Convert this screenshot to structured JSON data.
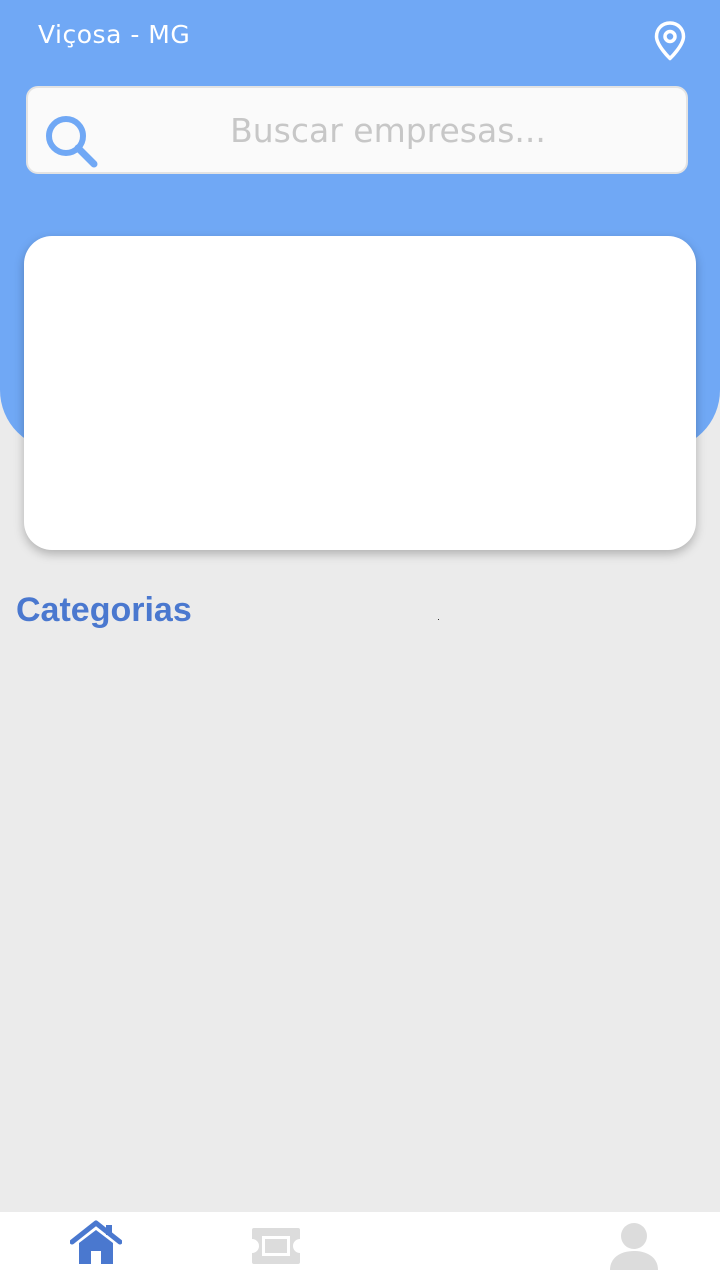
{
  "header": {
    "location": "Viçosa - MG",
    "location_icon": "map-pin-icon"
  },
  "search": {
    "placeholder": "Buscar empresas...",
    "value": "",
    "icon": "search-icon"
  },
  "main": {
    "section_title": "Categorias"
  },
  "bottom_nav": {
    "items": [
      {
        "id": "home",
        "icon": "home-icon",
        "active": true
      },
      {
        "id": "tickets",
        "icon": "ticket-icon",
        "active": false
      },
      {
        "id": "profile",
        "icon": "user-icon",
        "active": false
      }
    ]
  },
  "colors": {
    "header_bg": "#70a8f5",
    "accent": "#4a78cf",
    "page_bg": "#ebebeb",
    "inactive_icon": "#dcdcdc"
  }
}
